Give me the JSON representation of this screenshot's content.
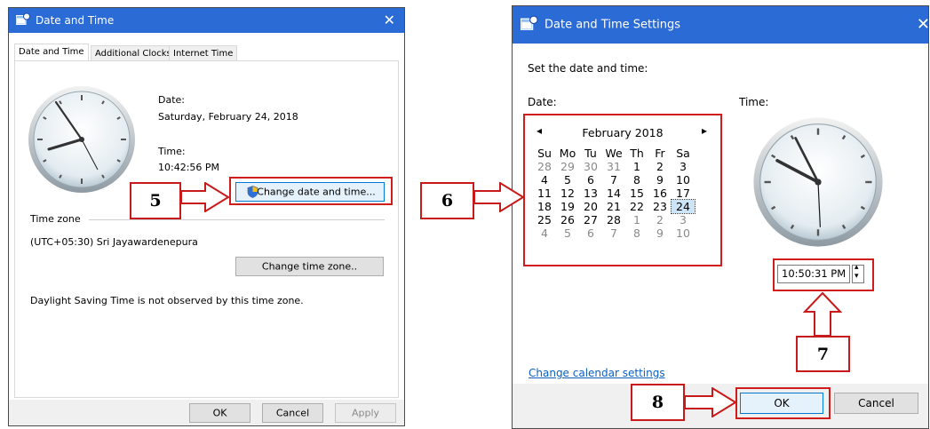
{
  "left_dialog": {
    "title": "Date and Time",
    "close_glyph": "✕",
    "tabs": [
      "Date and Time",
      "Additional Clocks",
      "Internet Time"
    ],
    "date_label": "Date:",
    "date_value": "Saturday, February 24, 2018",
    "time_label": "Time:",
    "time_value": "10:42:56 PM",
    "change_datetime_button": "Change date and time...",
    "timezone_group": "Time zone",
    "timezone_value": "(UTC+05:30) Sri Jayawardenepura",
    "change_timezone_button": "Change time zone..",
    "dst_note": "Daylight Saving Time is not observed by this time zone.",
    "ok_button": "OK",
    "cancel_button": "Cancel",
    "apply_button": "Apply"
  },
  "right_dialog": {
    "title": "Date and Time Settings",
    "close_glyph": "✕",
    "heading": "Set the date and time:",
    "date_label": "Date:",
    "time_label": "Time:",
    "calendar": {
      "prev_glyph": "◂",
      "next_glyph": "▸",
      "month_year": "February 2018",
      "weekdays": [
        "Su",
        "Mo",
        "Tu",
        "We",
        "Th",
        "Fr",
        "Sa"
      ],
      "weeks": [
        [
          "28",
          "29",
          "30",
          "31",
          "1",
          "2",
          "3"
        ],
        [
          "4",
          "5",
          "6",
          "7",
          "8",
          "9",
          "10"
        ],
        [
          "11",
          "12",
          "13",
          "14",
          "15",
          "16",
          "17"
        ],
        [
          "18",
          "19",
          "20",
          "21",
          "22",
          "23",
          "24"
        ],
        [
          "25",
          "26",
          "27",
          "28",
          "1",
          "2",
          "3"
        ],
        [
          "4",
          "5",
          "6",
          "7",
          "8",
          "9",
          "10"
        ]
      ]
    },
    "time_value": "10:50:31 PM",
    "spin_up": "▴",
    "spin_down": "▾",
    "calendar_link": "Change calendar settings",
    "ok_button": "OK",
    "cancel_button": "Cancel"
  },
  "callouts": {
    "step5": "5",
    "step6": "6",
    "step7": "7",
    "step8": "8"
  },
  "colors": {
    "titlebar": "#2b6bd6",
    "callout_red": "#d11c1c",
    "link_blue": "#0b5fbf"
  }
}
